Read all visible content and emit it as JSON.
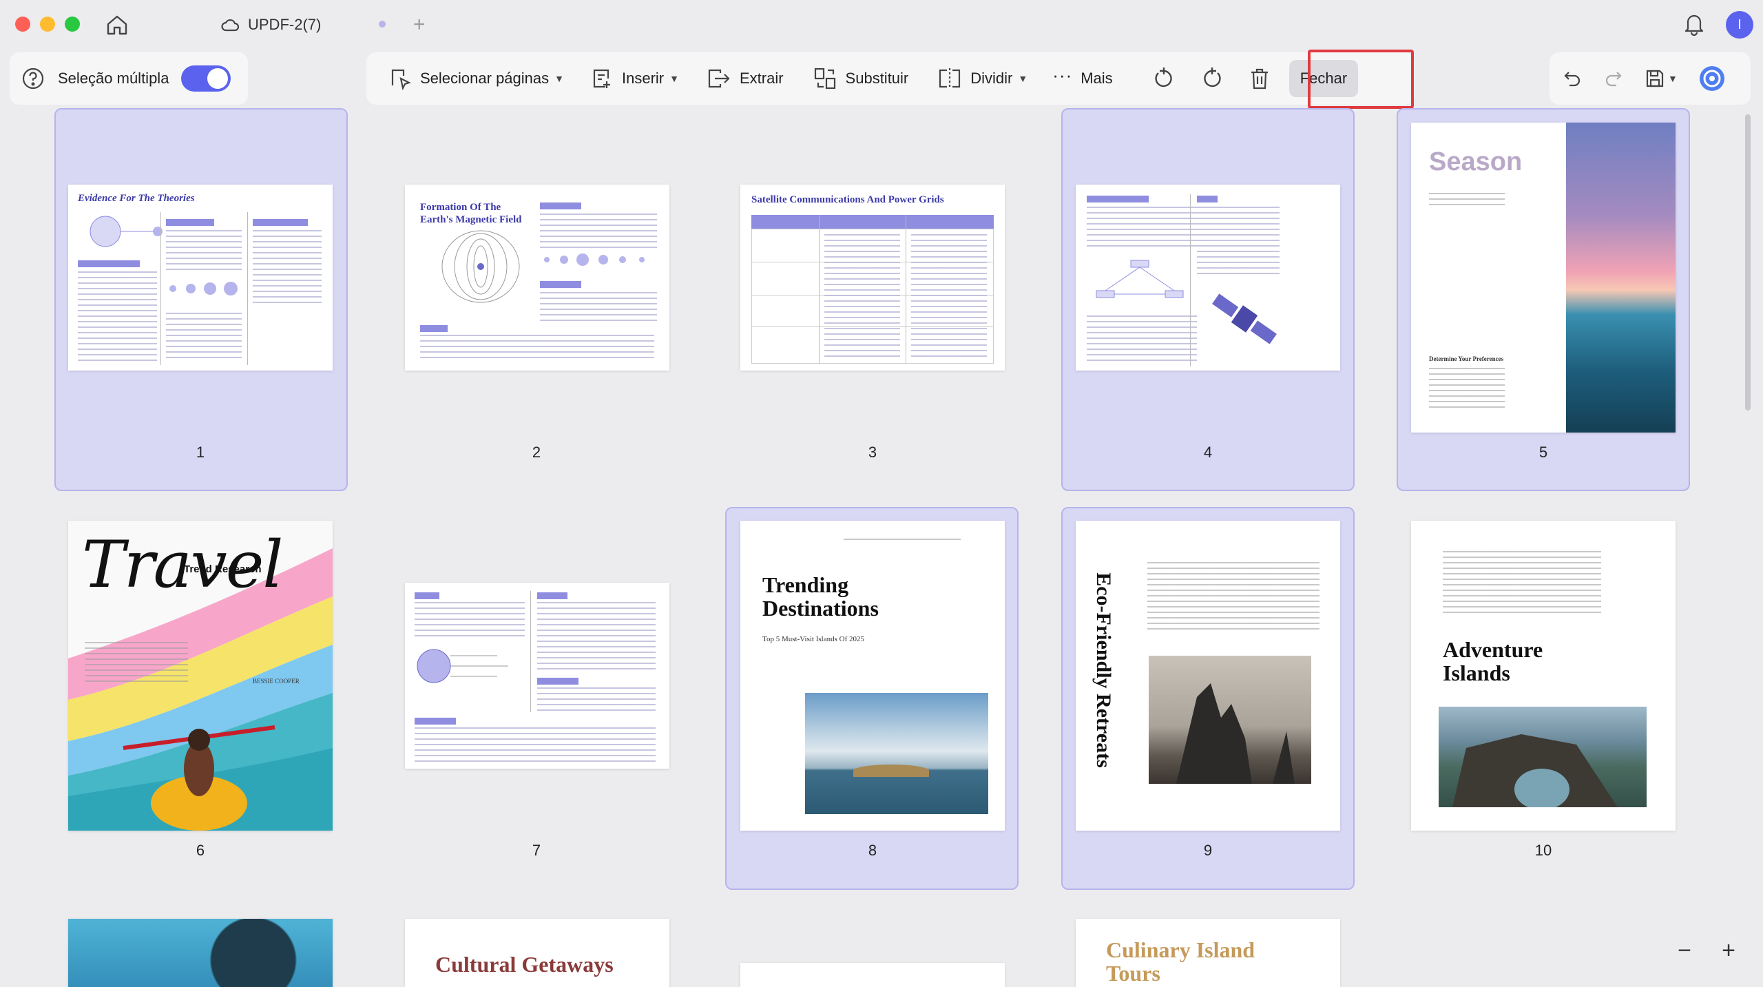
{
  "titlebar": {
    "tab_title": "UPDF-2(7)",
    "add_tab_label": "+",
    "avatar_initial": "I"
  },
  "toolbar": {
    "multi_select_label": "Seleção múltipla",
    "multi_select_on": true,
    "select_pages_label": "Selecionar páginas",
    "insert_label": "Inserir",
    "extract_label": "Extrair",
    "replace_label": "Substituir",
    "split_label": "Dividir",
    "more_label": "Mais",
    "close_label": "Fechar"
  },
  "pages": [
    {
      "number": "1",
      "selected": true,
      "title": "Evidence For The Theories"
    },
    {
      "number": "2",
      "selected": false,
      "title": "Formation Of The Earth's Magnetic Field"
    },
    {
      "number": "3",
      "selected": false,
      "title": "Satellite Communications And Power Grids"
    },
    {
      "number": "4",
      "selected": true,
      "title": ""
    },
    {
      "number": "5",
      "selected": true,
      "title": "Season",
      "subtitle": "Determine Your Preferences"
    },
    {
      "number": "6",
      "selected": false,
      "title": "Travel",
      "badge": "Trend Research",
      "author": "BESSIE COOPER"
    },
    {
      "number": "7",
      "selected": false,
      "title": ""
    },
    {
      "number": "8",
      "selected": true,
      "title": "Trending Destinations",
      "subtitle": "Top 5 Must-Visit Islands Of 2025"
    },
    {
      "number": "9",
      "selected": true,
      "title": "Eco-Friendly Retreats"
    },
    {
      "number": "10",
      "selected": false,
      "title": "Adventure Islands"
    },
    {
      "number": "",
      "selected": false,
      "title": ""
    },
    {
      "number": "",
      "selected": false,
      "title": "Cultural Getaways"
    },
    {
      "number": "",
      "selected": false,
      "title": ""
    },
    {
      "number": "",
      "selected": false,
      "title": "Culinary Island Tours"
    }
  ],
  "zoom": {
    "minus": "−",
    "plus": "+"
  },
  "colors": {
    "accent": "#5b63ee",
    "selection": "#d8d7f4",
    "highlight": "#e03a3e"
  }
}
